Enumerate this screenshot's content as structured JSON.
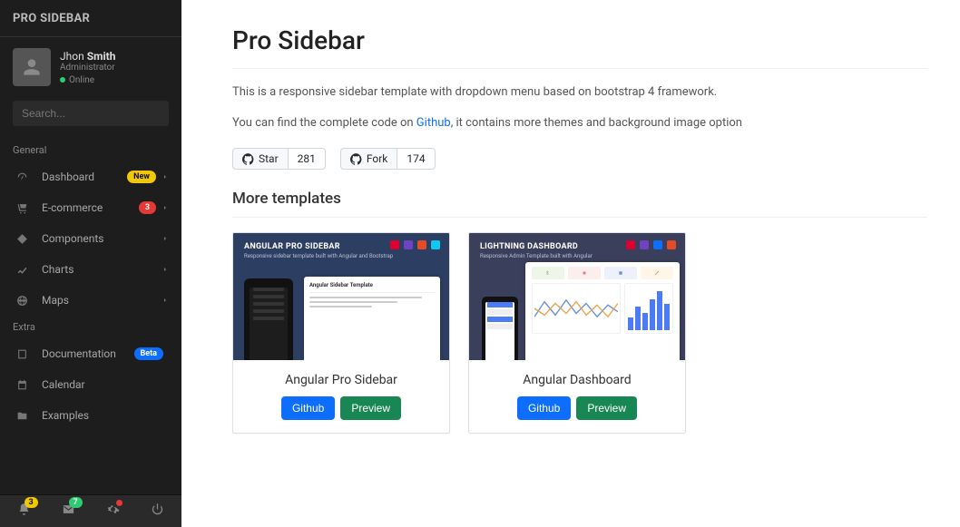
{
  "sidebar": {
    "brand": "PRO SIDEBAR",
    "user": {
      "firstname": "Jhon",
      "lastname": "Smith",
      "role": "Administrator",
      "status": "Online"
    },
    "search_placeholder": "Search...",
    "sections": {
      "general": "General",
      "extra": "Extra"
    },
    "items": {
      "dashboard": {
        "label": "Dashboard",
        "badge": "New"
      },
      "ecommerce": {
        "label": "E-commerce",
        "badge": "3"
      },
      "components": {
        "label": "Components"
      },
      "charts": {
        "label": "Charts"
      },
      "maps": {
        "label": "Maps"
      },
      "documentation": {
        "label": "Documentation",
        "badge": "Beta"
      },
      "calendar": {
        "label": "Calendar"
      },
      "examples": {
        "label": "Examples"
      }
    },
    "footer": {
      "bell_count": "3",
      "mail_count": "7"
    }
  },
  "main": {
    "title": "Pro Sidebar",
    "desc1": "This is a responsive sidebar template with dropdown menu based on bootstrap 4 framework.",
    "desc2_a": "You can find the complete code on ",
    "desc2_link": "Github",
    "desc2_b": ", it contains more themes and background image option",
    "github": {
      "star_label": "Star",
      "star_count": "281",
      "fork_label": "Fork",
      "fork_count": "174"
    },
    "more_title": "More templates",
    "cards": [
      {
        "banner": "ANGULAR PRO SIDEBAR",
        "sub": "Responsive sidebar template built with Angular and Bootstrap",
        "mock_header": "Angular Sidebar Template",
        "title": "Angular Pro Sidebar",
        "btn_github": "Github",
        "btn_preview": "Preview"
      },
      {
        "banner": "LIGHTNING DASHBOARD",
        "sub": "Responsive Admin Template built with Angular",
        "title": "Angular Dashboard",
        "btn_github": "Github",
        "btn_preview": "Preview"
      }
    ]
  }
}
